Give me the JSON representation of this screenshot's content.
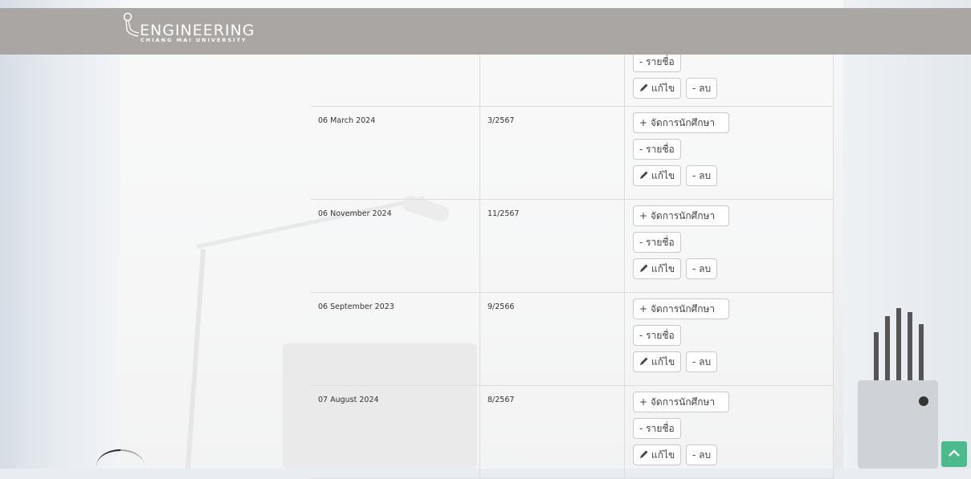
{
  "header": {
    "logo_title": "ENGINEERING",
    "logo_subtitle": "CHIANG MAI UNIVERSITY"
  },
  "table": {
    "first_row_partial": {
      "list_label": "- รายชื่อ",
      "edit_label": "แก้ไข",
      "delete_label": "- ลบ"
    },
    "rows": [
      {
        "date": "06 March 2024",
        "term": "3/2567",
        "manage_label": "+ จัดการนักศึกษา",
        "list_label": "- รายชื่อ",
        "edit_label": "แก้ไข",
        "delete_label": "- ลบ"
      },
      {
        "date": "06 November 2024",
        "term": "11/2567",
        "manage_label": "+ จัดการนักศึกษา",
        "list_label": "- รายชื่อ",
        "edit_label": "แก้ไข",
        "delete_label": "- ลบ"
      },
      {
        "date": "06 September 2023",
        "term": "9/2566",
        "manage_label": "+ จัดการนักศึกษา",
        "list_label": "- รายชื่อ",
        "edit_label": "แก้ไข",
        "delete_label": "- ลบ"
      },
      {
        "date": "07 August 2024",
        "term": "8/2567",
        "manage_label": "+ จัดการนักศึกษา",
        "list_label": "- รายชื่อ",
        "edit_label": "แก้ไข",
        "delete_label": "- ลบ"
      }
    ]
  },
  "icons": {
    "edit": "pencil-icon",
    "scroll_top": "chevron-up-icon"
  },
  "colors": {
    "header_bg": "#a9a6a3",
    "scroll_top_bg": "#4cbb8c"
  }
}
